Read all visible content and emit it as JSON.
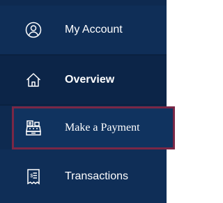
{
  "nav": {
    "items": [
      {
        "label": "My Account",
        "icon": "user-circle-icon",
        "active": false
      },
      {
        "label": "Overview",
        "icon": "home-icon",
        "active": true
      },
      {
        "label": "Make a Payment",
        "icon": "cash-register-icon",
        "active": false,
        "focused": true
      },
      {
        "label": "Transactions",
        "icon": "receipt-icon",
        "active": false
      }
    ]
  },
  "colors": {
    "sidebar_bg": "#0e2a50",
    "focus_outline": "#7a2746",
    "text": "#ffffff"
  }
}
